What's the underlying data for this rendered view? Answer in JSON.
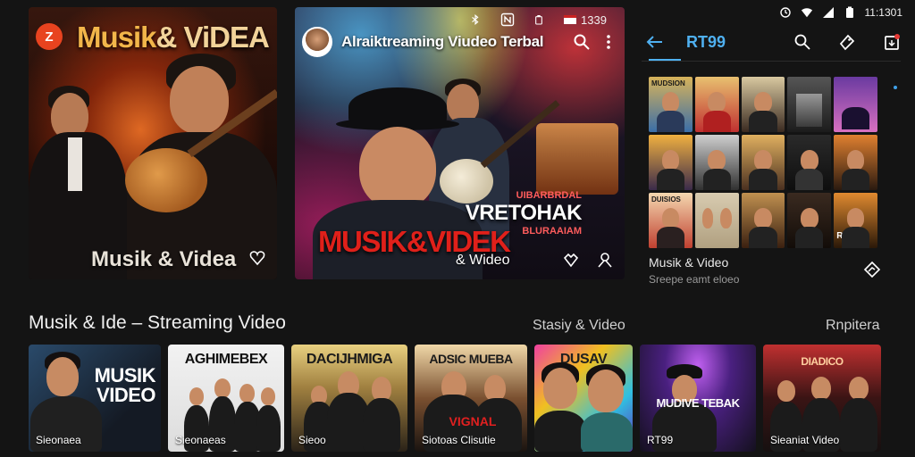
{
  "status_bar": {
    "left_icons": [
      "bluetooth-icon",
      "nfc-icon",
      "battery-small-icon",
      "screen-icon"
    ],
    "left_time": "1339",
    "right_icons": [
      "alarm-icon",
      "wifi-icon",
      "signal-icon",
      "battery-icon"
    ],
    "right_time": "11:1301"
  },
  "featured_left": {
    "logo_letter": "Z",
    "title_part1": "Musik",
    "title_part2": "& ViDEA",
    "caption": "Musik & Videa",
    "colors": {
      "logo": "#e8431f",
      "title": "#f2b64a"
    }
  },
  "featured_mid": {
    "title": "Alraiktreaming Viudeo Terbal",
    "overlay_big": "VRETOHAK",
    "overlay_small_top": "UIBARBRDAL",
    "overlay_small_bottom": "BLURAAIAM",
    "big_title": "MUSIK&VIDEK",
    "caption": "& Wideo"
  },
  "right_panel": {
    "tab": "RT99",
    "grid_labels": [
      "MUDSION",
      "",
      "",
      "",
      "",
      "",
      "",
      "",
      "",
      "",
      "DUISIOS",
      "",
      "",
      "",
      "RUIIO"
    ],
    "caption": "Musik & Video",
    "subcaption": "Sreepe eamt eloeo",
    "accent": "#4fb0f0"
  },
  "bottom_row": {
    "title": "Musik & Ide – Streaming Video",
    "mid_label": "Stasiy & Video",
    "right_label": "Rnpitera",
    "items": [
      {
        "title": "MUSIK VIDEO",
        "caption": "Sieonaea"
      },
      {
        "title": "AGHIMEBEX",
        "caption": "Sieonaeas"
      },
      {
        "title": "DACIJHMIGA",
        "caption": "Sieoo"
      },
      {
        "title": "ADSIC MUEBA",
        "caption": "Siotoas Clisutie"
      },
      {
        "title": "DUSAV",
        "caption": ""
      },
      {
        "title": "MUDIVE TEBAK",
        "caption": "RT99"
      },
      {
        "title": "DIADICO",
        "caption": "Sieaniat Video"
      }
    ]
  }
}
